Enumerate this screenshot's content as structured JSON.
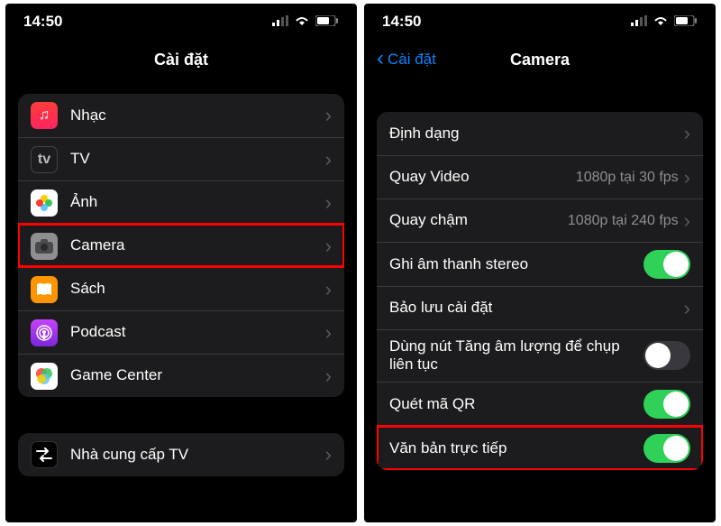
{
  "status": {
    "time": "14:50"
  },
  "left": {
    "title": "Cài đặt",
    "items": [
      {
        "label": "Nhạc"
      },
      {
        "label": "TV"
      },
      {
        "label": "Ảnh"
      },
      {
        "label": "Camera"
      },
      {
        "label": "Sách"
      },
      {
        "label": "Podcast"
      },
      {
        "label": "Game Center"
      }
    ],
    "tv_provider": "Nhà cung cấp TV"
  },
  "right": {
    "back": "Cài đặt",
    "title": "Camera",
    "rows": {
      "format": "Định dạng",
      "record_video": "Quay Video",
      "record_video_value": "1080p tại 30 fps",
      "slow_mo": "Quay chậm",
      "slow_mo_value": "1080p tại 240 fps",
      "stereo": "Ghi âm thanh stereo",
      "preserve": "Bảo lưu cài đặt",
      "burst": "Dùng nút Tăng âm lượng để chụp liên tục",
      "qr": "Quét mã QR",
      "live_text": "Văn bản trực tiếp"
    }
  }
}
